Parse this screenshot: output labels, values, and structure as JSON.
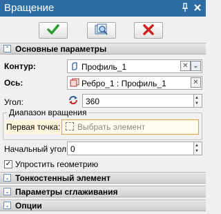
{
  "window": {
    "title": "Вращение",
    "pin_icon": "pin-icon",
    "close_icon": "close-icon"
  },
  "toolbar": {
    "ok_icon": "checkmark-icon",
    "preview_icon": "preview-icon",
    "cancel_icon": "cancel-x-icon",
    "colors": {
      "ok": "#2aa02a",
      "cancel": "#d02020"
    }
  },
  "main_params": {
    "header": "Основные параметры",
    "contour": {
      "label": "Контур:",
      "value": "Профиль_1"
    },
    "axis": {
      "label": "Ось:",
      "value": "Ребро_1 : Профиль_1"
    },
    "angle": {
      "label": "Угол:",
      "value": "360"
    },
    "rotation_range": {
      "legend": "Диапазон вращения",
      "first_point_label": "Первая точка:",
      "first_point_placeholder": "Выбрать элемент"
    },
    "start_angle": {
      "label": "Начальный угол:",
      "value": "0"
    },
    "simplify": {
      "label": "Упростить геометрию",
      "checked": true
    }
  },
  "sections": [
    {
      "label": "Тонкостенный элемент"
    },
    {
      "label": "Параметры сглаживания"
    },
    {
      "label": "Опции"
    }
  ]
}
